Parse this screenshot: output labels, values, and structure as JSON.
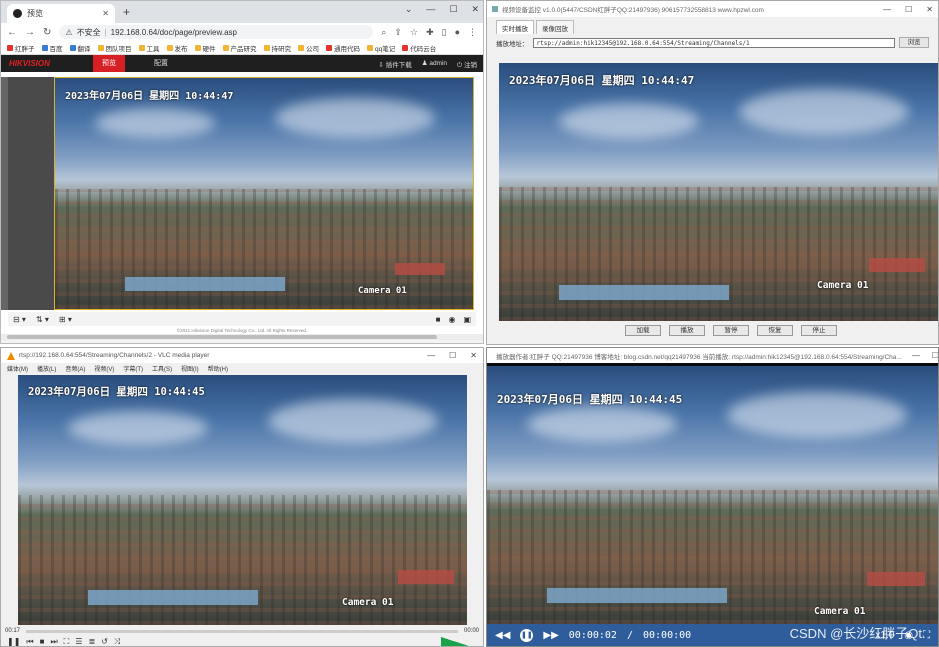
{
  "chrome": {
    "tab_title": "预览",
    "url_warning": "不安全",
    "url": "192.168.0.64/doc/page/preview.asp",
    "bookmarks": [
      "红胖子",
      "百度",
      "翻译",
      "团队项目",
      "工具",
      "发布",
      "硬件",
      "产品研究",
      "持研究",
      "公司",
      "通用代码",
      "qq笔记",
      "代码云台"
    ],
    "hik": {
      "logo": "HIKVISION",
      "tabs": [
        "预览",
        "配置"
      ],
      "plugin_download": "插件下载",
      "user": "admin",
      "logout": "注销"
    },
    "copyright": "©2021 Hikvision Digital Technology Co., Ltd. All Rights Reserved.",
    "osd_date": "2023年07月06日 星期四 10:44:47",
    "osd_camera": "Camera 01"
  },
  "app": {
    "title": "视频设备监控 v1.0.0(5447/CSDN红胖子QQ:21497936) 906157732558813 www.hpzwl.com",
    "tabs": [
      "实时播放",
      "录像回放"
    ],
    "address_label": "播放地址：",
    "address_value": "rtsp://admin:hik12345@192.168.0.64:554/Streaming/Channels/1",
    "browse_label": "浏览",
    "osd_date": "2023年07月06日 星期四 10:44:47",
    "osd_camera": "Camera 01",
    "buttons": [
      "加载",
      "播放",
      "暂停",
      "恢复",
      "停止"
    ]
  },
  "vlc": {
    "title": "rtsp://192.168.0.64:554/Streaming/Channels/2 - VLC media player",
    "menu": [
      "媒体(M)",
      "播放(L)",
      "音频(A)",
      "视频(V)",
      "字幕(T)",
      "工具(S)",
      "视图(I)",
      "帮助(H)"
    ],
    "elapsed": "00:17",
    "total": "00:00",
    "osd_date": "2023年07月06日 星期四 10:44:45",
    "osd_camera": "Camera 01"
  },
  "player": {
    "title": "播放器作者:红胖子 QQ:21497936 博客地址: blog.csdn.net/qq21497936 当前播放: rtsp://admin:hik12345@192.168.0.64:554/Streaming/Cha...",
    "osd_date": "2023年07月06日 星期四 10:44:45",
    "osd_camera": "Camera 01",
    "current_time": "00:00:02",
    "separator": "/",
    "duration": "00:00:00",
    "speed": "x1.0",
    "watermark": "CSDN @长沙红胖子Qt"
  }
}
